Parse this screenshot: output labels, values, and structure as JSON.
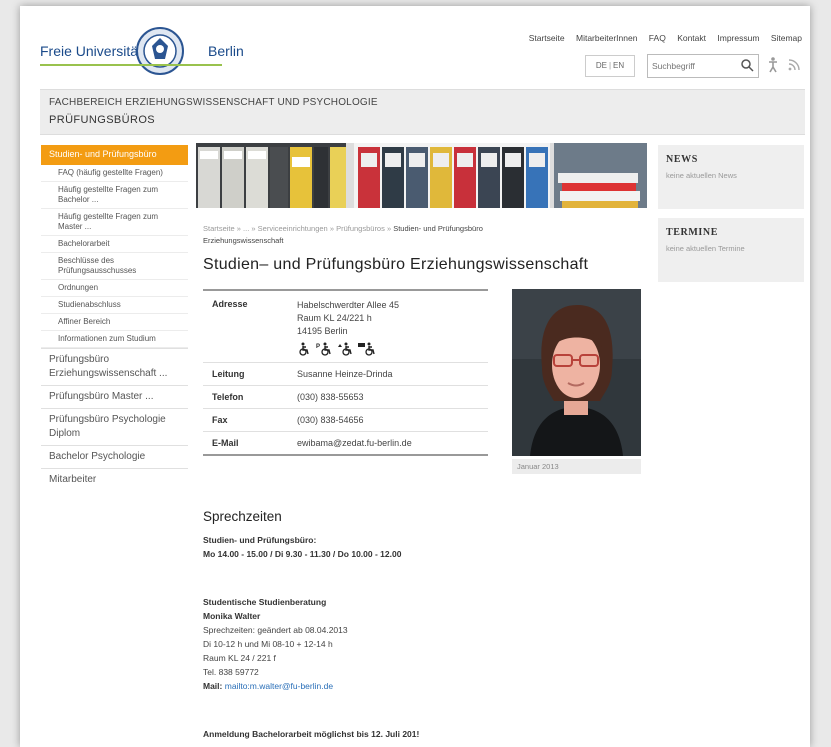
{
  "header": {
    "logo_left": "Freie Universität",
    "logo_right": "Berlin",
    "service_nav": [
      "Startseite",
      "MitarbeiterInnen",
      "FAQ",
      "Kontakt",
      "Impressum",
      "Sitemap"
    ],
    "lang": {
      "de": "DE",
      "en": "EN"
    },
    "search_placeholder": "Suchbegriff",
    "accent_green": "#99c24d"
  },
  "band": {
    "department": "FACHBEREICH ERZIEHUNGSWISSENSCHAFT UND PSYCHOLOGIE",
    "institution": "PRÜFUNGSBÜROS"
  },
  "sidebar": {
    "active": "Studien- und Prüfungsbüro",
    "subitems": [
      "FAQ (häufig gestellte Fragen)",
      "Häufig gestellte Fragen zum Bachelor ...",
      "Häufig gestellte Fragen zum Master ...",
      "Bachelorarbeit",
      "Beschlüsse des Prüfungsausschusses",
      "Ordnungen",
      "Studienabschluss",
      "Affiner Bereich",
      "Informationen zum Studium"
    ],
    "main_items": [
      "Prüfungsbüro Erziehungswissenschaft ...",
      "Prüfungsbüro Master ...",
      "Prüfungsbüro Psychologie Diplom",
      "Bachelor Psychologie",
      "Mitarbeiter"
    ],
    "accent_orange": "#f39c12"
  },
  "news": {
    "title": "NEWS",
    "text": "keine aktuellen News"
  },
  "termine": {
    "title": "TERMINE",
    "text": "keine aktuellen Termine"
  },
  "breadcrumb": {
    "items": [
      "Startseite",
      "...",
      "Serviceeinrichtungen",
      "Prüfungsbüros"
    ],
    "sep": "»",
    "current": "Studien- und Prüfungsbüro Erziehungswissenschaft"
  },
  "main": {
    "title": "Studien– und Prüfungsbüro Erziehungswissenschaft",
    "contact": {
      "address_label": "Adresse",
      "address_lines": [
        "Habelschwerdter Allee 45",
        "Raum KL 24/221 h",
        "14195 Berlin"
      ],
      "accessibility_icons": [
        "wheelchair-icon",
        "wheelchair-parking-icon",
        "wheelchair-elevator-icon",
        "wheelchair-toilet-icon"
      ],
      "leitung_label": "Leitung",
      "leitung": "Susanne Heinze-Drinda",
      "telefon_label": "Telefon",
      "telefon": "(030) 838-55653",
      "fax_label": "Fax",
      "fax": "(030) 838-54656",
      "email_label": "E-Mail",
      "email": "ewibama@zedat.fu-berlin.de"
    },
    "photo_caption": "Januar 2013",
    "sprechzeiten": {
      "title": "Sprechzeiten",
      "office_title": "Studien- und Prüfungsbüro:",
      "office_hours": "Mo 14.00 - 15.00 / Di 9.30 - 11.30 / Do 10.00 - 12.00",
      "beratung_title": "Studentische Studienberatung",
      "beratung_name": "Monika Walter",
      "beratung_lines": [
        "Sprechzeiten: geändert ab 08.04.2013",
        "Di 10-12 h und Mi 08-10 + 12-14 h",
        "Raum KL 24 / 221 f",
        "Tel. 838 59772"
      ],
      "mail_label": "Mail:",
      "mail_link": "mailto:m.walter@fu-berlin.de",
      "notice": "Anmeldung Bachelorarbeit möglichst bis 12. Juli 201!"
    }
  }
}
